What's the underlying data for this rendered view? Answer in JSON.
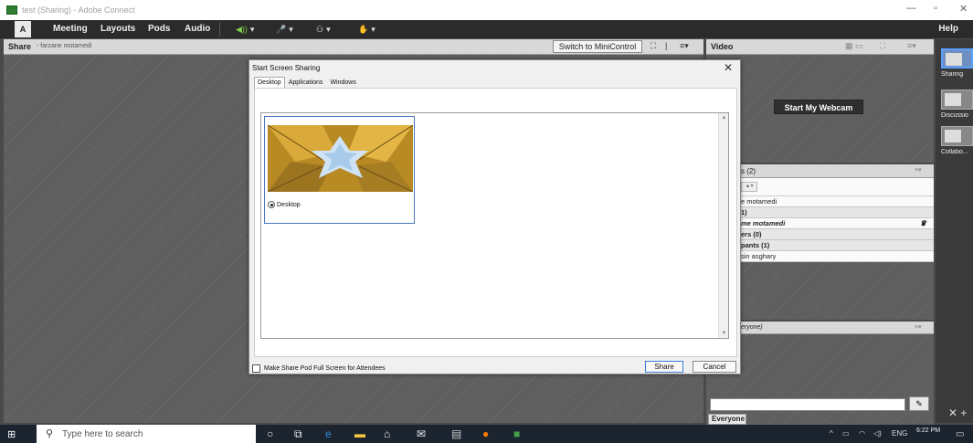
{
  "window": {
    "title": "test (Sharing) - Adobe Connect",
    "minimize": "—",
    "restore": "▫",
    "close": "✕"
  },
  "menu": {
    "logo": "A",
    "items": [
      "Meeting",
      "Layouts",
      "Pods",
      "Audio"
    ],
    "help": "Help"
  },
  "share_pod": {
    "title": "Share",
    "presenter": "- farzane motamedi",
    "mini_control_label": "Switch to MiniControl"
  },
  "video_pod": {
    "title": "Video",
    "webcam_button": "Start My Webcam"
  },
  "attendees_pod": {
    "header": "s  (2)",
    "rows": [
      {
        "text": "e motamedi",
        "style": "white"
      },
      {
        "text": "1)",
        "style": "grey"
      },
      {
        "text": "me motamedi",
        "style": "italic"
      },
      {
        "text": "ers (0)",
        "style": "grey"
      },
      {
        "text": "pants (1)",
        "style": "grey"
      },
      {
        "text": "sin asghary",
        "style": "white"
      }
    ]
  },
  "chat_pod": {
    "header": "eryone)",
    "everyone_tab": "Everyone"
  },
  "layouts_panel": {
    "items": [
      "Sharing",
      "Discussio",
      "Collabo..."
    ]
  },
  "dialog": {
    "title": "Start Screen Sharing",
    "tabs": [
      "Desktop",
      "Applications",
      "Windows"
    ],
    "active_tab": "Desktop",
    "option_label": "Desktop",
    "fullscreen_checkbox_label": "Make Share Pod Full Screen for Attendees",
    "share_button": "Share",
    "cancel_button": "Cancel"
  },
  "taskbar": {
    "search_placeholder": "Type here to search",
    "language": "ENG",
    "time": "6:22 PM"
  },
  "colors": {
    "accent": "#3b7bd4",
    "audio_green": "#7fd34a"
  }
}
